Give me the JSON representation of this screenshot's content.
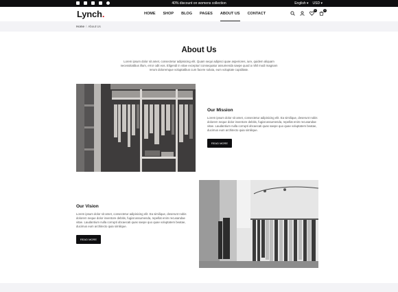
{
  "topbar": {
    "social_icons": [
      "facebook-icon",
      "twitter-icon",
      "instagram-icon",
      "linkedin-icon",
      "pinterest-icon"
    ],
    "promo": "40% discount on womens collection",
    "language": "English",
    "currency": "USD"
  },
  "header": {
    "logo": "Lynch",
    "logo_dot": ".",
    "nav": [
      "HOME",
      "SHOP",
      "BLOG",
      "PAGES",
      "ABOUT US",
      "CONTACT"
    ],
    "active_nav": "ABOUT US",
    "icons": [
      "search-icon",
      "user-icon",
      "heart-icon",
      "cart-icon"
    ],
    "wishlist_count": "0",
    "cart_count": "0"
  },
  "breadcrumb": {
    "home": "Home",
    "separator": "/",
    "current": "About Us"
  },
  "about": {
    "title": "About Us",
    "text": "Lorem ipsum dolor sit amet, consectetur adipisicing elit. Quam sequi adipisci quae asperiores, iure, quidem aliquam necessitatibus illum, error odit eos. Eligendi in vitae excepturi consequatur assumenda saepe quod a nihil modi magnam rerum doloremque voluptatibus cum facere soluta, eum voluptate cupiditate."
  },
  "mission": {
    "title": "Our Mission",
    "text": "Lorem ipsum dolor sit amet, consectetur adipisicing elit. Ea similique, deserunt nobis dolorem neque dolor inventore debitis, fugiat assumenda, repellat enim recusandae vitae. Laudantium nulla corrupti obcaecati quas saepe quo quae voluptatem beatae, ducimus eum architecto quia similique.",
    "button": "Read More"
  },
  "vision": {
    "title": "Our Vision",
    "text": "Lorem ipsum dolor sit amet, consectetur adipisicing elit. Ea similique, deserunt nobis dolorem neque dolor inventore debitis, fugiat assumenda, repellat enim recusandae vitae. Laudantium nulla corrupti obcaecati quas saepe quo quae voluptatem beatae, ducimus eum architecto quia similique.",
    "button": "Read More"
  },
  "colors": {
    "dark": "#0e0e10",
    "accent": "#d2232a",
    "light_bg": "#f3f3f6"
  }
}
